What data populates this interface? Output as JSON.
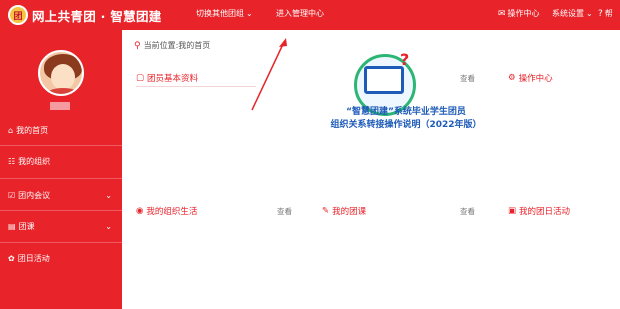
{
  "header": {
    "logo_text": "团",
    "brand": "网上共青团 · 智慧团建",
    "nav": [
      {
        "label": "切换其他团组",
        "chevron": "⌄"
      },
      {
        "label": "进入管理中心"
      }
    ],
    "right": {
      "ops_label": "操作中心",
      "settings_label": "系统设置",
      "help_label": "帮"
    }
  },
  "sidebar": {
    "items": [
      {
        "label": "我的首页"
      },
      {
        "label": "我的组织"
      },
      {
        "label": "团内会议"
      },
      {
        "label": "团课"
      },
      {
        "label": "团日活动"
      }
    ]
  },
  "main": {
    "breadcrumb": "当前位置:我的首页",
    "sections": {
      "profile": "团员基本资料",
      "ops": "操作中心",
      "org_life": "我的组织生活",
      "my_class": "我的团课",
      "my_activity": "我的团日活动",
      "view": "查看"
    },
    "title_line1": "“智慧团建”系统毕业学生团员",
    "title_line2": "组织关系转接操作说明（2022年版）"
  },
  "colors": {
    "brand_red": "#e8232a",
    "title_blue": "#1e5bb8",
    "accent_green": "#2bb673"
  },
  "icons": [
    "location-pin-icon",
    "mail-icon",
    "gear-icon",
    "question-icon",
    "home-icon",
    "group-icon",
    "meeting-icon",
    "book-icon",
    "activity-icon",
    "chevron-down-icon"
  ]
}
